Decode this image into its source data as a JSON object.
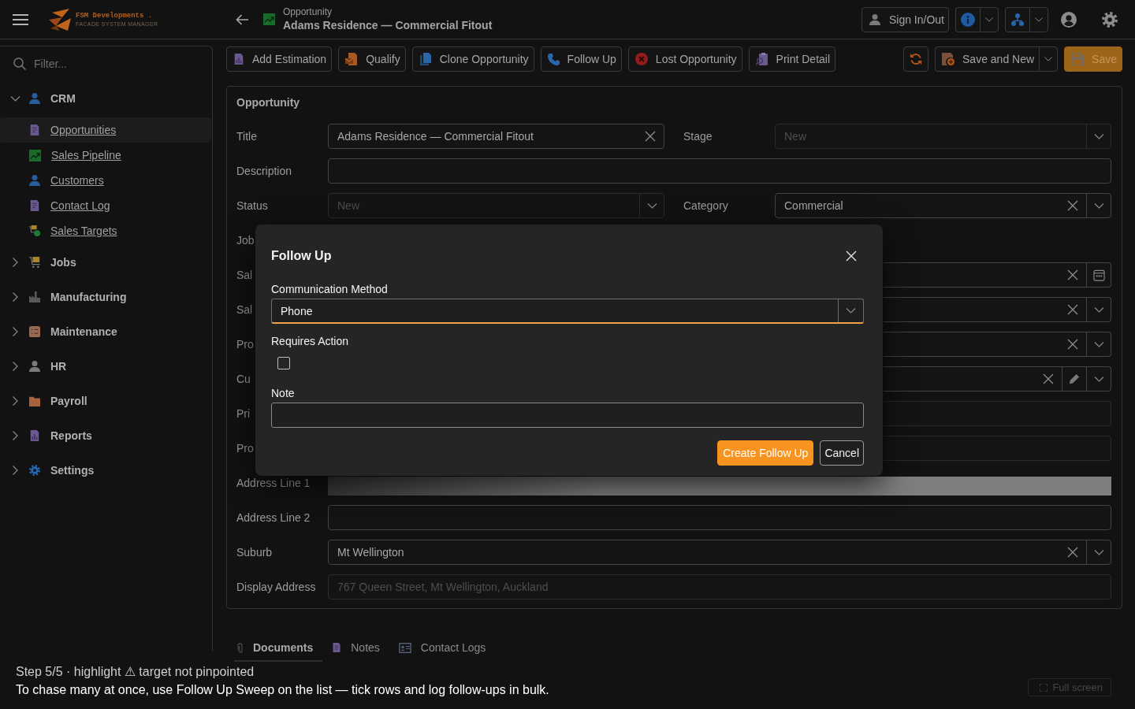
{
  "header": {
    "brand": "FSM Developments .",
    "tagline": "FACADE SYSTEM MANAGER",
    "breadcrumb": "Opportunity",
    "title": "Adams Residence — Commercial Fitout",
    "sign_in_out": "Sign In/Out"
  },
  "sidebar": {
    "filter_placeholder": "Filter...",
    "groups": [
      {
        "label": "CRM",
        "expanded": true,
        "children": [
          {
            "label": "Opportunities",
            "selected": true
          },
          {
            "label": "Sales Pipeline",
            "selected": false
          },
          {
            "label": "Customers",
            "selected": false
          },
          {
            "label": "Contact Log",
            "selected": false
          },
          {
            "label": "Sales Targets",
            "selected": false
          }
        ]
      },
      {
        "label": "Jobs",
        "expanded": false
      },
      {
        "label": "Manufacturing",
        "expanded": false
      },
      {
        "label": "Maintenance",
        "expanded": false
      },
      {
        "label": "HR",
        "expanded": false
      },
      {
        "label": "Payroll",
        "expanded": false
      },
      {
        "label": "Reports",
        "expanded": false
      },
      {
        "label": "Settings",
        "expanded": false
      }
    ]
  },
  "toolbar": {
    "actions": [
      "Add Estimation",
      "Qualify",
      "Clone Opportunity",
      "Follow Up",
      "Lost Opportunity",
      "Print Detail"
    ],
    "save_and_new": "Save and New",
    "save": "Save"
  },
  "form": {
    "title": "Opportunity",
    "rows": [
      {
        "cells": [
          {
            "label": "Title",
            "kind": "text",
            "value": "Adams Residence — Commercial Fitout",
            "clearable": true
          },
          {
            "label": "Stage",
            "kind": "select",
            "value": "New",
            "disabled": true
          }
        ]
      },
      {
        "cells": [
          {
            "label": "Description",
            "kind": "text"
          }
        ]
      },
      {
        "cells": [
          {
            "label": "Status",
            "kind": "select",
            "value": "New",
            "disabled": true
          },
          {
            "label": "Category",
            "kind": "select",
            "value": "Commercial",
            "clearable": true
          }
        ]
      },
      {
        "cells": [
          {
            "label": "Job"
          }
        ]
      },
      {
        "under_dialog": true,
        "cells": [
          {
            "label": "Sal",
            "kind": "date",
            "clearable": true
          }
        ]
      },
      {
        "under_dialog": true,
        "cells": [
          {
            "label": "Sal",
            "kind": "select",
            "clearable": true
          }
        ]
      },
      {
        "under_dialog": true,
        "cells": [
          {
            "label": "Pro",
            "kind": "select",
            "clearable": true
          }
        ]
      },
      {
        "under_dialog": true,
        "cells": [
          {
            "label": "Cu",
            "kind": "lookup",
            "clearable": true
          }
        ]
      },
      {
        "under_dialog": true,
        "cells": [
          {
            "label": "Pri",
            "kind": "text",
            "disabled": true
          }
        ]
      },
      {
        "under_dialog": true,
        "cells": [
          {
            "label": "Pro",
            "kind": "text",
            "disabled": true
          }
        ]
      },
      {
        "cells": [
          {
            "label": "Address Line 1",
            "kind": "text",
            "highlighted": true
          }
        ]
      },
      {
        "cells": [
          {
            "label": "Address Line 2",
            "kind": "text"
          }
        ]
      },
      {
        "cells": [
          {
            "label": "Suburb",
            "kind": "select",
            "value": "Mt Wellington",
            "clearable": true
          }
        ]
      },
      {
        "cells": [
          {
            "label": "Display Address",
            "kind": "text",
            "value": "767 Queen Street, Mt Wellington, Auckland",
            "disabled": true
          }
        ]
      }
    ]
  },
  "dialog": {
    "title": "Follow Up",
    "fields": [
      {
        "kind": "select",
        "label": "Communication Method",
        "value": "Phone",
        "focused": true
      },
      {
        "kind": "checkbox",
        "label": "Requires Action",
        "checked": false
      },
      {
        "kind": "text",
        "label": "Note"
      }
    ],
    "buttons": [
      {
        "kind": "primary",
        "label": "Create Follow Up"
      },
      {
        "kind": "secondary",
        "label": "Cancel"
      }
    ]
  },
  "tabs": [
    {
      "label": "Documents",
      "selected": true
    },
    {
      "label": "Notes",
      "selected": false
    },
    {
      "label": "Contact Logs",
      "selected": false
    }
  ],
  "full_screen": "Full screen",
  "tutorial": {
    "step": "Step 5/5 · highlight ⚠ target not pinpointed",
    "message": "To chase many at once, use Follow Up Sweep on the list — tick rows and log follow-ups in bulk."
  }
}
